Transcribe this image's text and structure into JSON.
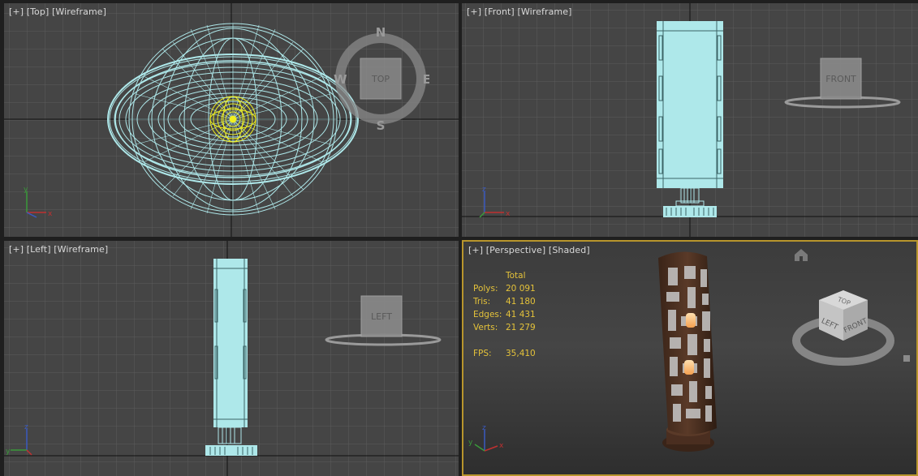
{
  "viewports": {
    "top": {
      "label_plus": "[+]",
      "label_view": "[Top]",
      "label_mode": "[Wireframe]",
      "cube_label": "TOP",
      "compass": {
        "n": "N",
        "s": "S",
        "e": "E",
        "w": "W"
      }
    },
    "front": {
      "label_plus": "[+]",
      "label_view": "[Front]",
      "label_mode": "[Wireframe]",
      "cube_label": "FRONT"
    },
    "left": {
      "label_plus": "[+]",
      "label_view": "[Left]",
      "label_mode": "[Wireframe]",
      "cube_label": "LEFT"
    },
    "perspective": {
      "label_plus": "[+]",
      "label_view": "[Perspective]",
      "label_mode": "[Shaded]",
      "cube_labels": {
        "top": "TOP",
        "left": "LEFT",
        "front": "FRONT"
      },
      "stats": {
        "header": "Total",
        "polys_label": "Polys:",
        "polys": "20 091",
        "tris_label": "Tris:",
        "tris": "41 180",
        "edges_label": "Edges:",
        "edges": "41 431",
        "verts_label": "Verts:",
        "verts": "21 279",
        "fps_label": "FPS:",
        "fps": "35,410"
      }
    }
  },
  "axes": {
    "x": "x",
    "y": "y",
    "z": "z"
  },
  "colors": {
    "wire": "#aee8ea",
    "selected": "#f0f020",
    "active_border": "#b8952c",
    "stats": "#e4c23a",
    "viewport_bg": "#444444",
    "grid": "#5a5a5a"
  },
  "icons": [
    "home-icon",
    "viewcube",
    "compass",
    "axis-tripod",
    "viewcube-menu-icon"
  ]
}
